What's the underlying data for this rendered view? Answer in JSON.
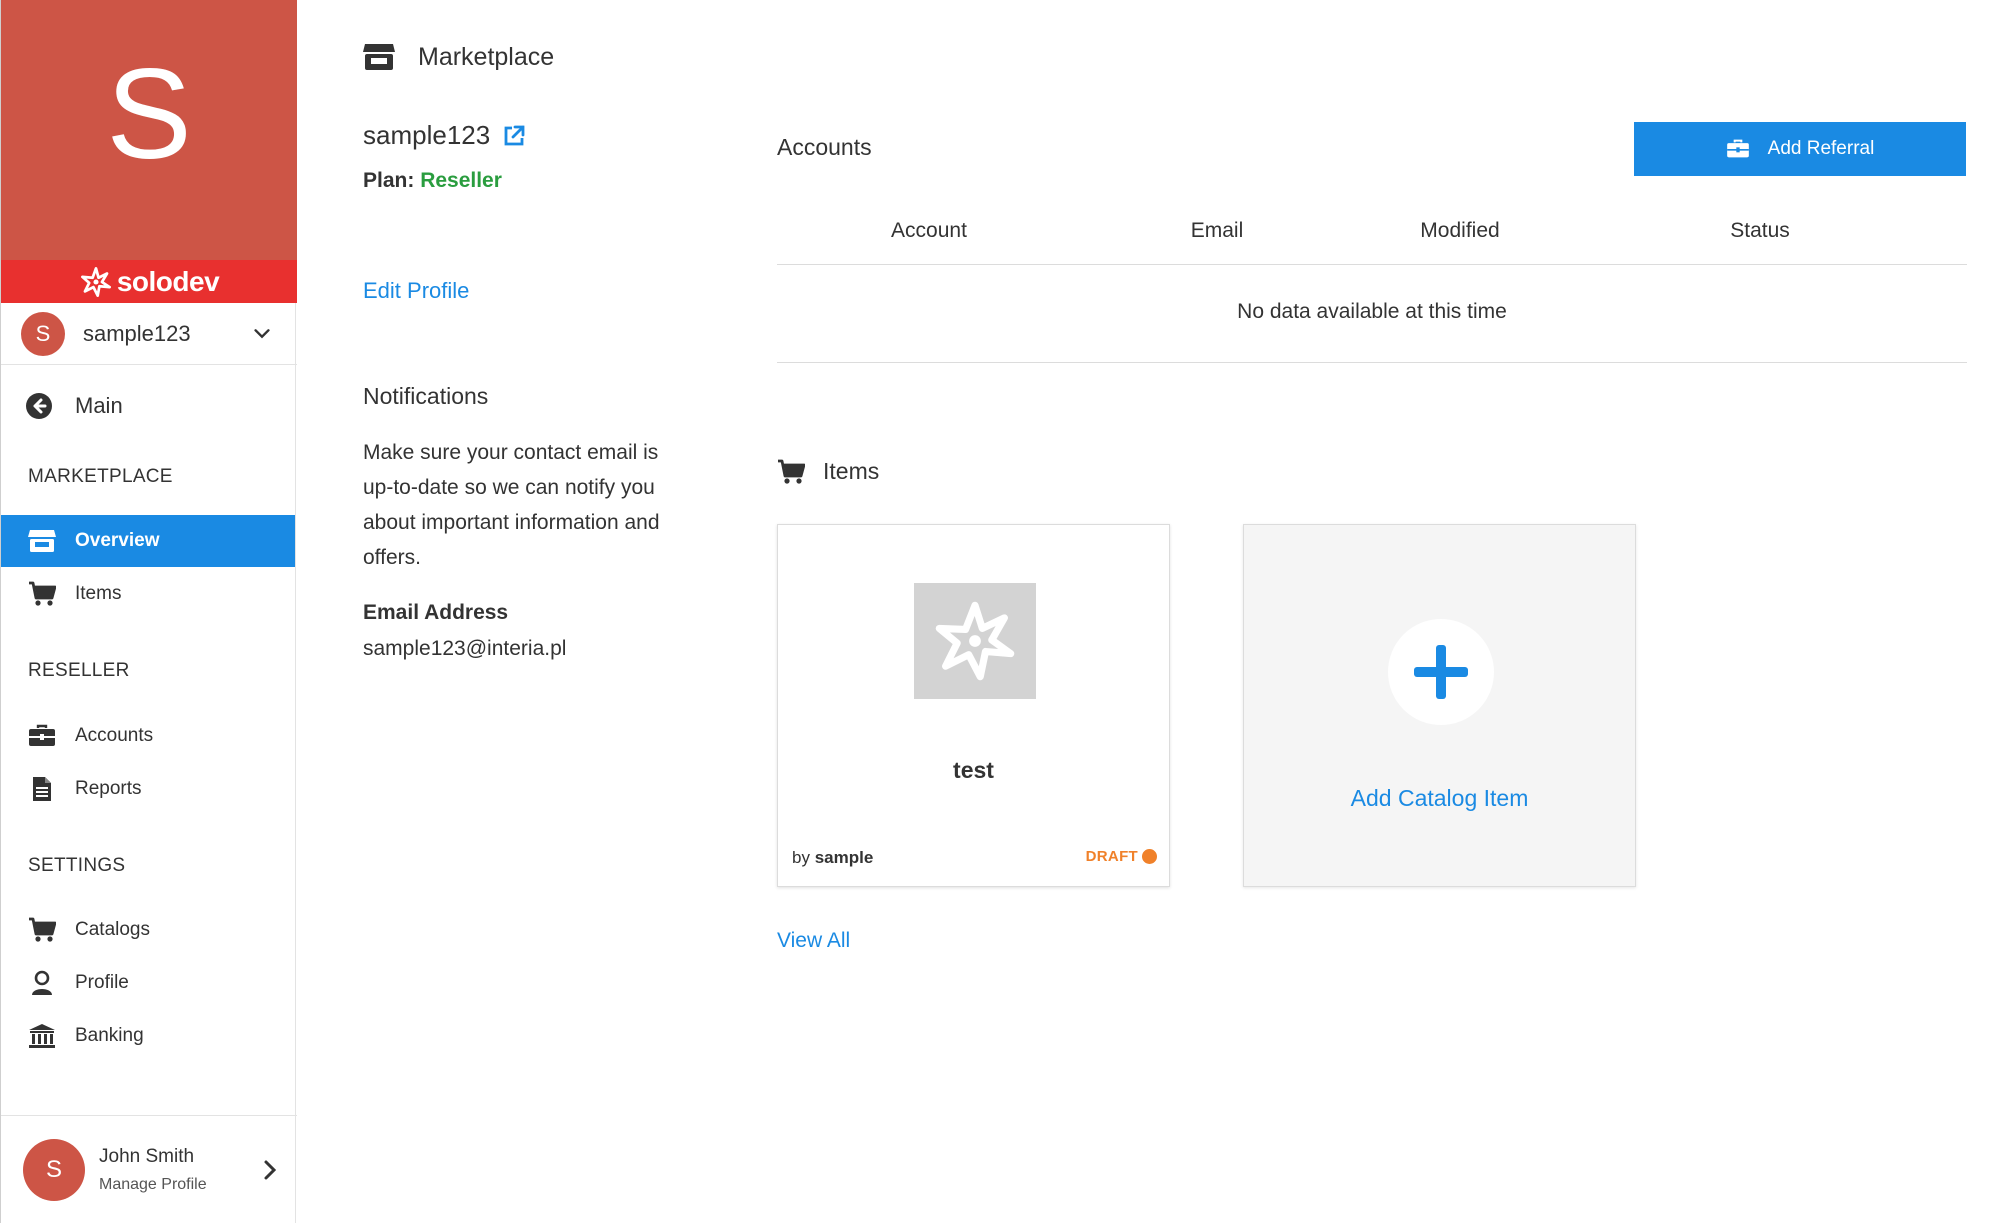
{
  "brand": {
    "letter": "S",
    "name": "solodev",
    "color": "#cd5546",
    "bar_color": "#e8302f"
  },
  "account_switcher": {
    "avatar_initial": "S",
    "name": "sample123"
  },
  "nav": {
    "main_label": "Main",
    "sections": {
      "marketplace": "MARKETPLACE",
      "reseller": "RESELLER",
      "settings": "SETTINGS"
    },
    "items": {
      "overview": "Overview",
      "items": "Items",
      "accounts": "Accounts",
      "reports": "Reports",
      "catalogs": "Catalogs",
      "profile": "Profile",
      "banking": "Banking"
    },
    "active": "overview",
    "accent": "#1a8ae3"
  },
  "user_footer": {
    "avatar_initial": "S",
    "name": "John Smith",
    "subtitle": "Manage Profile"
  },
  "header": {
    "title": "Marketplace",
    "icon": "store-icon"
  },
  "profile": {
    "name": "sample123",
    "plan_label": "Plan:",
    "plan_value": "Reseller",
    "edit_link": "Edit Profile",
    "notifications_title": "Notifications",
    "notifications_text": "Make sure your contact email is up-to-date so we can notify you about important information and offers.",
    "email_label": "Email Address",
    "email_value": "sample123@interia.pl"
  },
  "accounts": {
    "title": "Accounts",
    "add_button": "Add Referral",
    "columns": [
      "Account",
      "Email",
      "Modified",
      "Status"
    ],
    "empty_message": "No data available at this time"
  },
  "items": {
    "title": "Items",
    "cards": [
      {
        "name": "test",
        "by_prefix": "by",
        "author": "sample",
        "status": "DRAFT",
        "status_color": "#f0812a"
      }
    ],
    "add_card_label": "Add Catalog Item",
    "view_all": "View All"
  }
}
